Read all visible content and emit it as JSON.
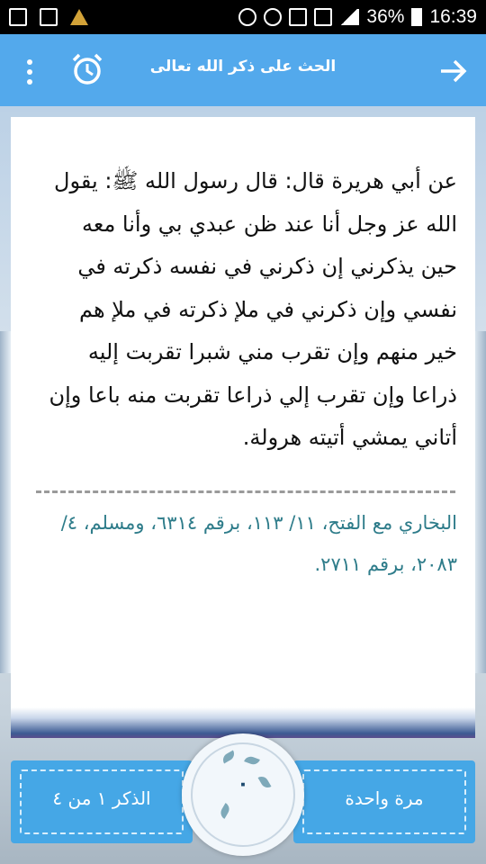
{
  "status_bar": {
    "battery": "36%",
    "time": "16:39"
  },
  "app_bar": {
    "title": "الحث على ذكر الله تعالى"
  },
  "hadith": {
    "text": "عن أبي هريرة قال: قال رسول الله ﷺ: يقول الله عز وجل أنا عند ظن عبدي بي وأنا معه حين يذكرني إن ذكرني في نفسه ذكرته في نفسي وإن ذكرني في ملإ ذكرته في ملإ هم خير منهم وإن تقرب مني شبرا تقربت إليه ذراعا وإن تقرب إلي ذراعا تقربت منه باعا وإن أتاني يمشي أتيته هرولة.",
    "source": "البخاري مع الفتح، ١١/ ١١٣، برقم ٦٣١٤، ومسلم، ٤/ ٢٠٨٣، برقم ٢٧١١."
  },
  "counter": {
    "repeat_label": "مرة واحدة",
    "count": "٠",
    "progress_label": "الذكر ١ من ٤"
  },
  "colors": {
    "app_bar": "#53a9ec",
    "counter_box": "#45a7e6",
    "source_text": "#2e7c8a"
  }
}
